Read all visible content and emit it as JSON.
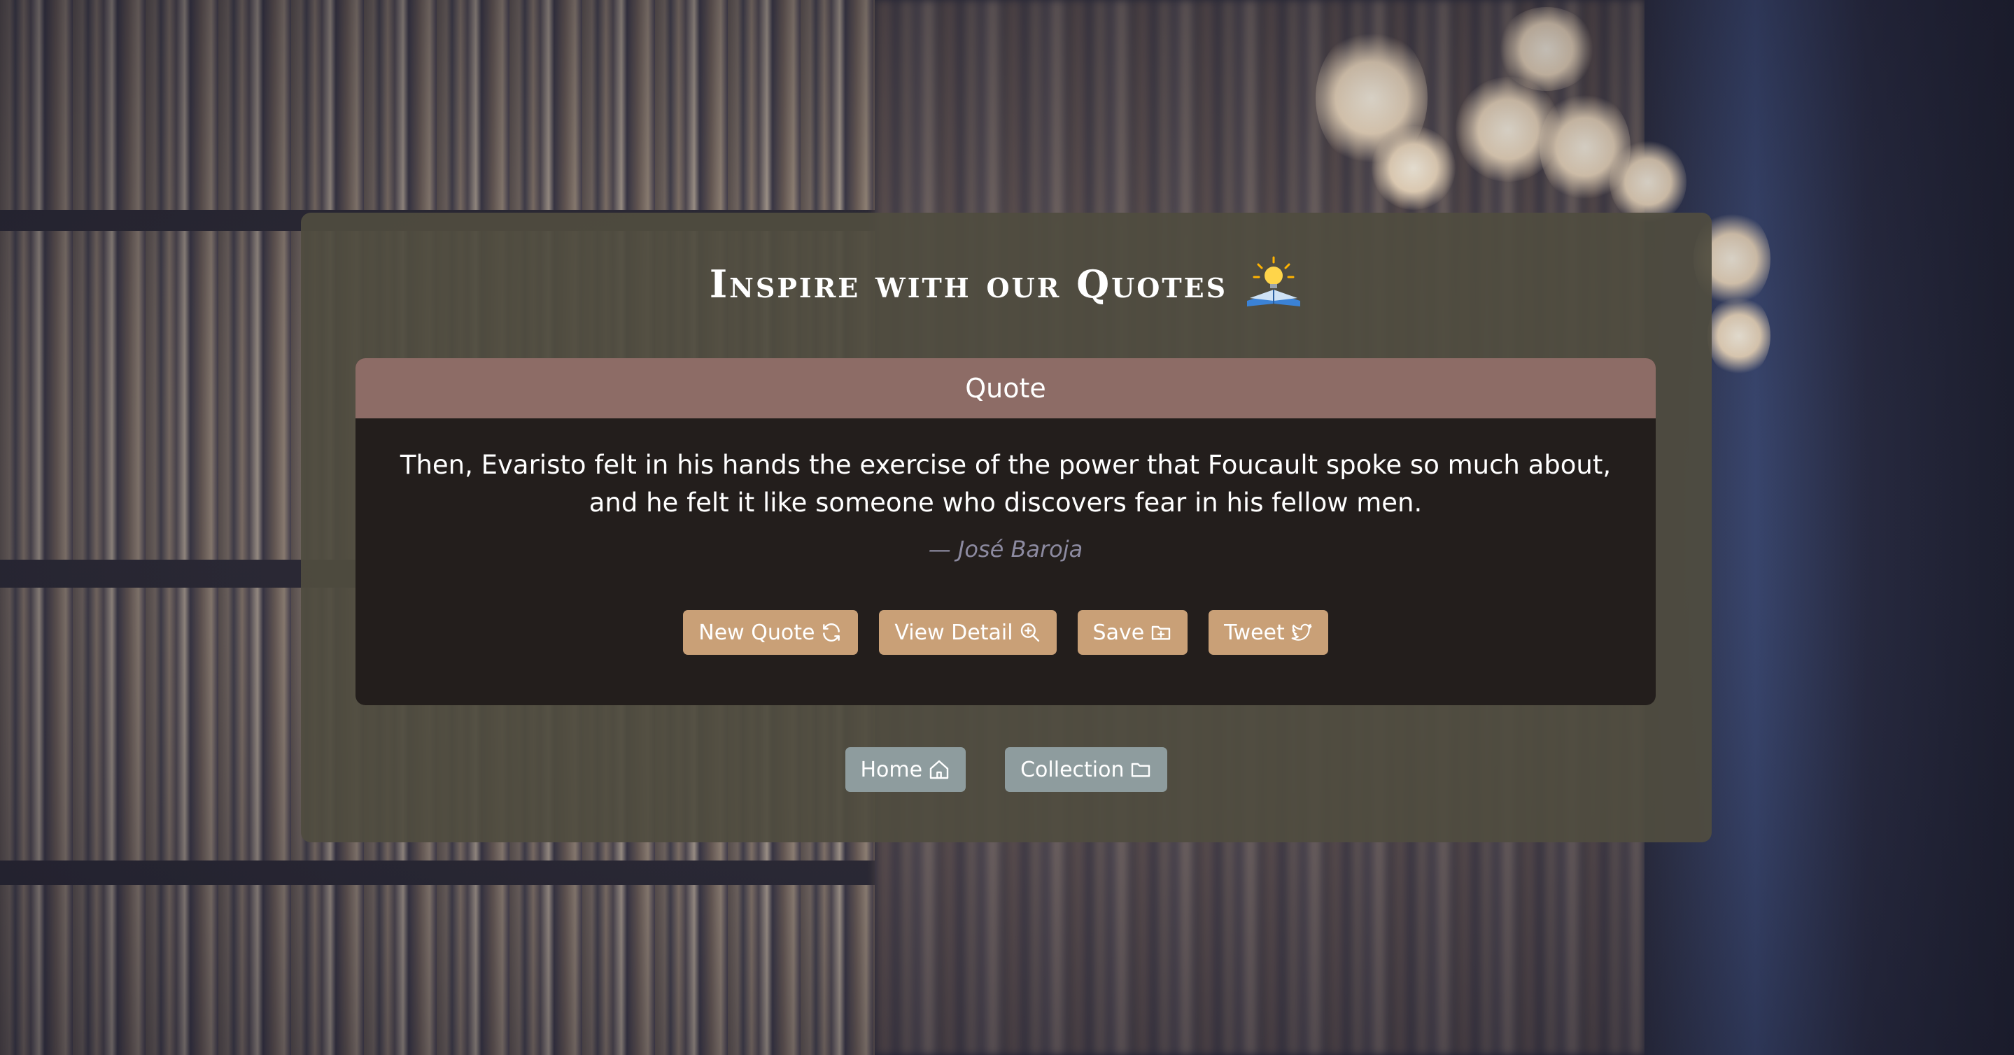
{
  "header": {
    "title": "Inspire with our Quotes",
    "title_icon": "lightbulb-book-icon"
  },
  "quote_card": {
    "header_label": "Quote",
    "text": "Then, Evaristo felt in his hands the exercise of the power that Foucault spoke so much about, and he felt it like someone who discovers fear in his fellow men.",
    "author": "— José Baroja"
  },
  "actions": {
    "new_quote": {
      "label": "New Quote",
      "icon": "refresh-icon"
    },
    "view_detail": {
      "label": "View Detail",
      "icon": "zoom-in-icon"
    },
    "save": {
      "label": "Save",
      "icon": "folder-plus-icon"
    },
    "tweet": {
      "label": "Tweet",
      "icon": "twitter-icon"
    }
  },
  "nav": {
    "home": {
      "label": "Home",
      "icon": "home-icon"
    },
    "collection": {
      "label": "Collection",
      "icon": "folder-icon"
    }
  },
  "colors": {
    "panel": "#504c40",
    "card": "#231e1c",
    "card_header": "#8d6c66",
    "action_button": "#c9a077",
    "nav_button": "#8e9c9e",
    "author_text": "#8c8aa0"
  }
}
